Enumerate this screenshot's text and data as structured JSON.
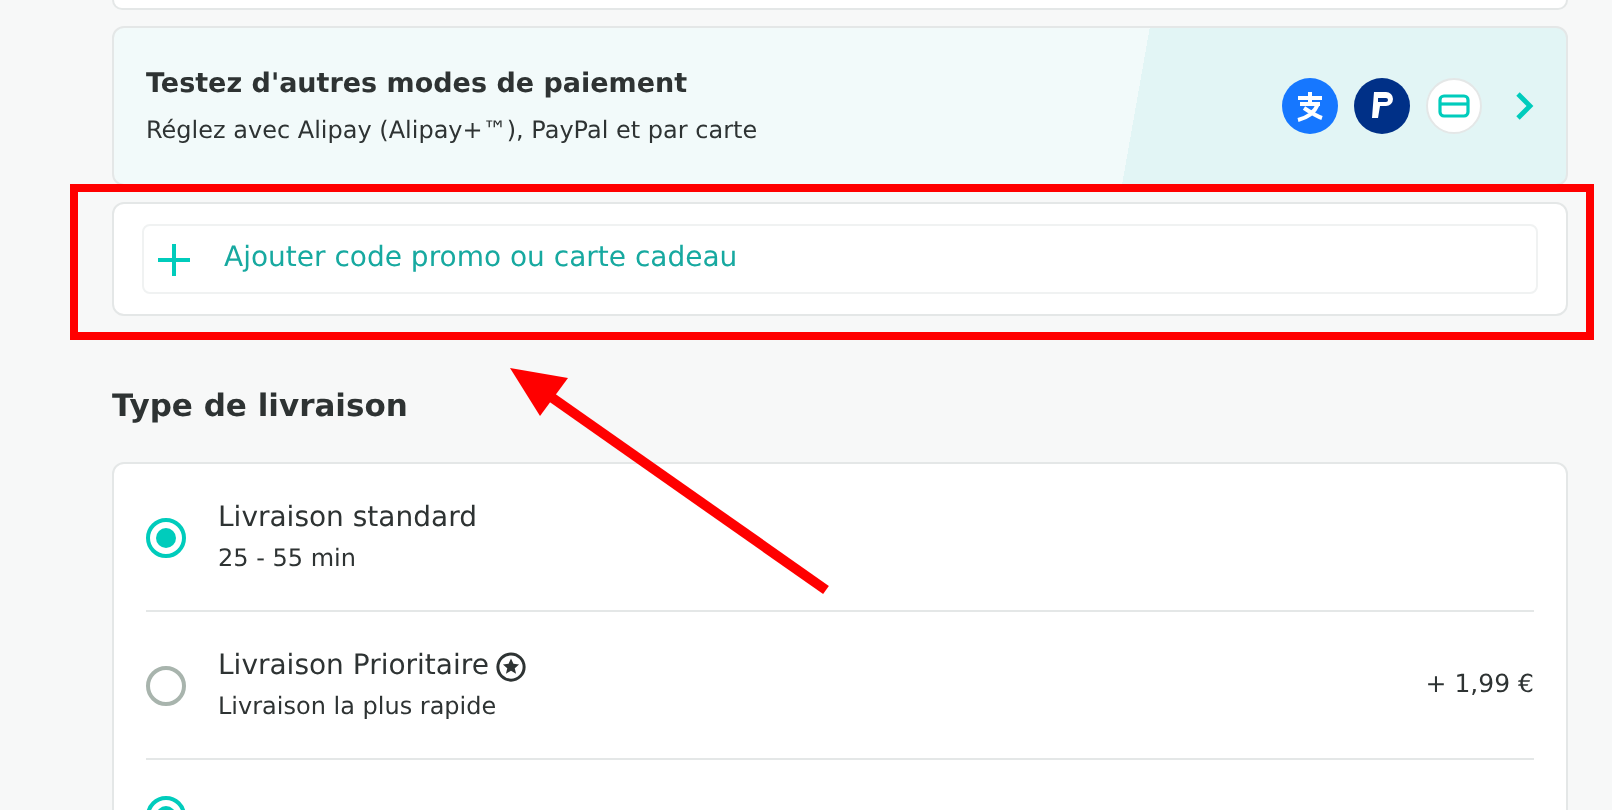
{
  "payment_promo": {
    "title": "Testez d'autres modes de paiement",
    "subtitle": "Réglez avec Alipay (Alipay+™), PayPal et par carte"
  },
  "promo_code": {
    "label": "Ajouter code promo ou carte cadeau"
  },
  "delivery": {
    "heading": "Type de livraison",
    "options": [
      {
        "kind": "radio",
        "title": "Livraison standard",
        "detail": "25 - 55 min",
        "priority": false,
        "selected": true
      },
      {
        "kind": "radio",
        "title": "Livraison Prioritaire",
        "detail": "Livraison la plus rapide",
        "price": "+ 1,99 €",
        "priority": true,
        "selected": false
      },
      {
        "kind": "radio_cut",
        "selected": true
      }
    ]
  }
}
